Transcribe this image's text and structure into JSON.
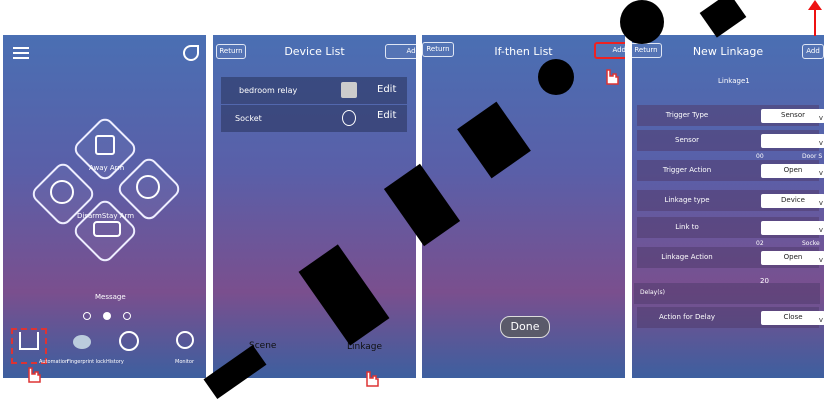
{
  "panel1": {
    "away_arm": "Away Arm",
    "disarm_stay_arm": "DisarmStay Arm",
    "message": "Message",
    "bottom_nav": [
      "Automation",
      "Fingerprint lock",
      "History",
      "Monitor"
    ]
  },
  "panel2": {
    "return": "Return",
    "title": "Device List",
    "add": "Add",
    "devices": [
      {
        "name": "bedroom relay",
        "action": "Edit"
      },
      {
        "name": "Socket",
        "action": "Edit"
      }
    ],
    "scene": "Scene",
    "linkage": "Linkage"
  },
  "panel3": {
    "return": "Return",
    "title": "If-then List",
    "add": "Add",
    "done": "Done"
  },
  "panel4": {
    "return": "Return",
    "title": "New Linkage",
    "add": "Add",
    "linkage_name": "Linkage1",
    "trigger_type_label": "Trigger Type",
    "trigger_type_value": "Sensor",
    "sensor_label": "Sensor",
    "sensor_code": "00",
    "sensor_name": "Door S",
    "trigger_action_label": "Trigger Action",
    "trigger_action_value": "Open",
    "linkage_type_label": "Linkage type",
    "linkage_type_value": "Device",
    "link_to_label": "Link to",
    "link_to_code": "02",
    "link_to_name": "Socke",
    "linkage_action_label": "Linkage Action",
    "linkage_action_value": "Open",
    "delay_label": "Delay(s)",
    "delay_value": "20",
    "action_for_delay_label": "Action for Delay",
    "action_for_delay_value": "Close"
  }
}
